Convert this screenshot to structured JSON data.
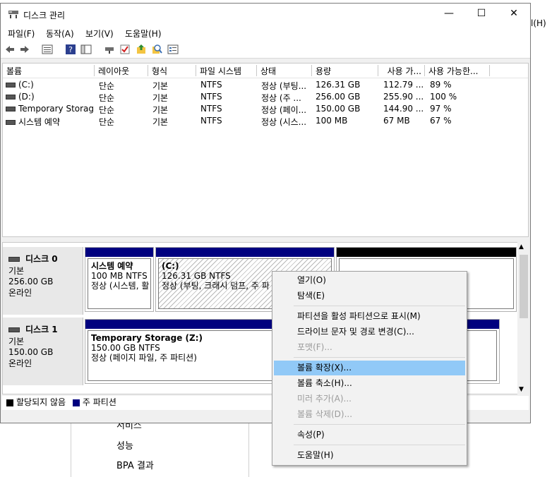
{
  "background": {
    "help_fragment": "l(H)",
    "items": [
      "서비스",
      "성능",
      "BPA 결과"
    ]
  },
  "window": {
    "title": "디스크 관리",
    "controls": {
      "minimize": "—",
      "maximize": "☐",
      "close": "✕"
    }
  },
  "menu": [
    "파일(F)",
    "동작(A)",
    "보기(V)",
    "도움말(H)"
  ],
  "toolbar_icons": [
    "back-icon",
    "forward-icon",
    "list-view-icon",
    "help-icon",
    "properties-icon",
    "connect-icon",
    "check-icon",
    "folder-up-icon",
    "search-icon",
    "details-icon"
  ],
  "table": {
    "headers": [
      "볼륨",
      "레이아웃",
      "형식",
      "파일 시스템",
      "상태",
      "용량",
      "사용 가...",
      "사용 가능한..."
    ],
    "rows": [
      [
        "(C:)",
        "단순",
        "기본",
        "NTFS",
        "정상 (부팅...",
        "126.31 GB",
        "112.79 ...",
        "89 %"
      ],
      [
        "(D:)",
        "단순",
        "기본",
        "NTFS",
        "정상 (주 ...",
        "256.00 GB",
        "255.90 ...",
        "100 %"
      ],
      [
        "Temporary Storag...",
        "단순",
        "기본",
        "NTFS",
        "정상 (페이...",
        "150.00 GB",
        "144.90 ...",
        "97 %"
      ],
      [
        "시스템 예약",
        "단순",
        "기본",
        "NTFS",
        "정상 (시스...",
        "100 MB",
        "67 MB",
        "67 %"
      ]
    ]
  },
  "disks": [
    {
      "name": "디스크 0",
      "type": "기본",
      "size": "256.00 GB",
      "status": "온라인",
      "partitions": [
        {
          "title": "시스템 예약",
          "size": "100 MB NTFS",
          "status": "정상 (시스템, 활"
        },
        {
          "title": "(C:)",
          "size": "126.31 GB NTFS",
          "status": "정상 (부팅, 크래시 덤프, 주 파"
        },
        {
          "title": "",
          "size": "",
          "status": ""
        }
      ]
    },
    {
      "name": "디스크 1",
      "type": "기본",
      "size": "150.00 GB",
      "status": "온라인",
      "partitions": [
        {
          "title": "Temporary Storage  (Z:)",
          "size": "150.00 GB NTFS",
          "status": "정상 (페이지 파일, 주 파티션)"
        }
      ]
    }
  ],
  "legend": [
    "할당되지 않음",
    "주 파티션"
  ],
  "colors": {
    "primary_partition": "#00007f",
    "unallocated": "#000000",
    "highlight": "#91c9f7"
  },
  "context_menu": [
    {
      "label": "열기(O)",
      "enabled": true
    },
    {
      "label": "탐색(E)",
      "enabled": true
    },
    {
      "label": "파티션을 활성 파티션으로 표시(M)",
      "enabled": true
    },
    {
      "label": "드라이브 문자 및 경로 변경(C)...",
      "enabled": true
    },
    {
      "label": "포맷(F)...",
      "enabled": false
    },
    {
      "label": "볼륨 확장(X)...",
      "enabled": true,
      "highlighted": true
    },
    {
      "label": "볼륨 축소(H)...",
      "enabled": true
    },
    {
      "label": "미러 추가(A)...",
      "enabled": false
    },
    {
      "label": "볼륨 삭제(D)...",
      "enabled": false
    },
    {
      "label": "속성(P)",
      "enabled": true
    },
    {
      "label": "도움말(H)",
      "enabled": true
    }
  ]
}
